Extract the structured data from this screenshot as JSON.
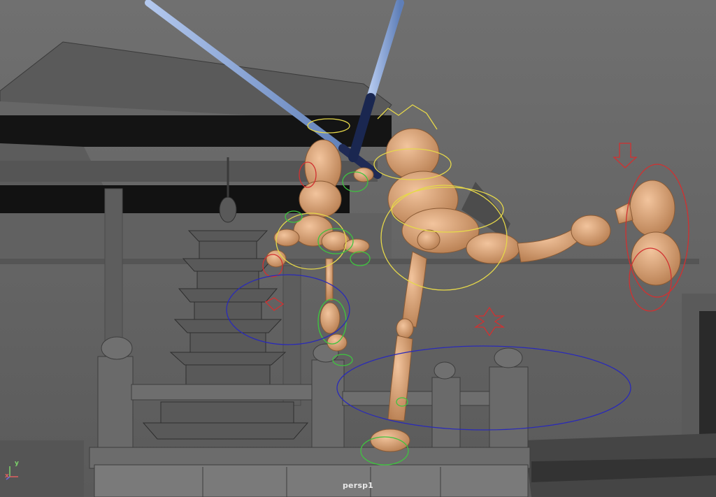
{
  "viewport": {
    "camera_name": "persp1",
    "axis_indicator": {
      "x_label": "x",
      "y_label": "y"
    }
  },
  "scene_objects": [
    "background-temple",
    "pagoda",
    "balustrade",
    "character-left",
    "character-right",
    "sword-left",
    "sword-right",
    "rig-controls"
  ],
  "colors": {
    "viewport_bg": "#6b6b6b",
    "building": "#5f5f5f",
    "skin": "#d9a57a",
    "control_yellow": "#e6d84a",
    "control_green": "#3fc43f",
    "control_red": "#d23030",
    "control_blue": "#2a2ab8",
    "sword_blade": "#8ba6d4"
  }
}
